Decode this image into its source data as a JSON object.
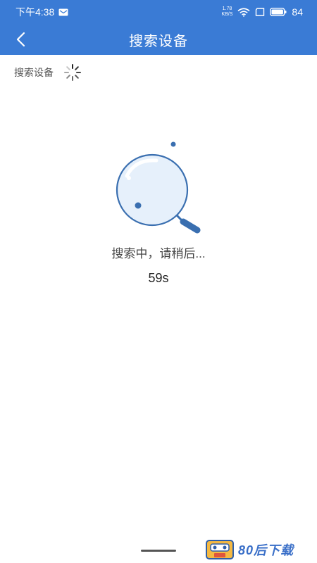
{
  "status_bar": {
    "time": "下午4:38",
    "net_speed_value": "1.78",
    "net_speed_unit": "KB/S",
    "battery": "84"
  },
  "header": {
    "title": "搜索设备"
  },
  "section": {
    "label": "搜索设备"
  },
  "search": {
    "status_text": "搜索中，请稍后...",
    "countdown": "59s"
  },
  "watermark": {
    "text": "80后下载"
  },
  "colors": {
    "primary": "#3a7bd5",
    "lens_fill": "#e6f0fb",
    "lens_stroke": "#3a6fb0"
  }
}
